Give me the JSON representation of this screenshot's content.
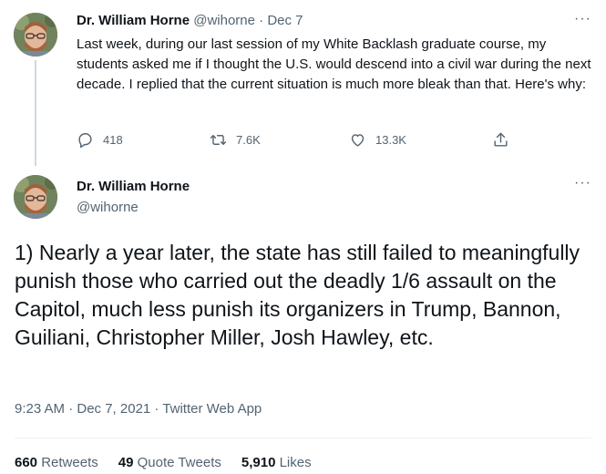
{
  "tweet1": {
    "author_name": "Dr. William Horne",
    "author_handle": "@wihorne",
    "separator": "·",
    "date": "Dec 7",
    "text": "Last week, during our last session of my White Backlash graduate course, my students asked me if I thought the U.S. would descend into a civil war during the next decade. I replied that the current situation is much more bleak than that. Here's why:",
    "reply_count": "418",
    "retweet_count": "7.6K",
    "like_count": "13.3K",
    "more_label": "···"
  },
  "tweet2": {
    "author_name": "Dr. William Horne",
    "author_handle": "@wihorne",
    "text": "1) Nearly a year later, the state has still failed to meaningfully punish those who carried out the deadly 1/6 assault on the Capitol, much less punish its organizers in Trump, Bannon, Guiliani, Christopher Miller, Josh Hawley, etc.",
    "meta": "9:23 AM · Dec 7, 2021 · Twitter Web App",
    "more_label": "···",
    "stats": {
      "retweets_count": "660",
      "retweets_label": "Retweets",
      "quotes_count": "49",
      "quotes_label": "Quote Tweets",
      "likes_count": "5,910",
      "likes_label": "Likes"
    }
  },
  "icons": {
    "reply": "reply-icon",
    "retweet": "retweet-icon",
    "like": "heart-icon",
    "share": "share-icon",
    "more": "more-icon"
  },
  "colors": {
    "text": "#0f1419",
    "muted": "#536471",
    "thread_line": "#cfd9de",
    "divider": "#eff3f4"
  }
}
